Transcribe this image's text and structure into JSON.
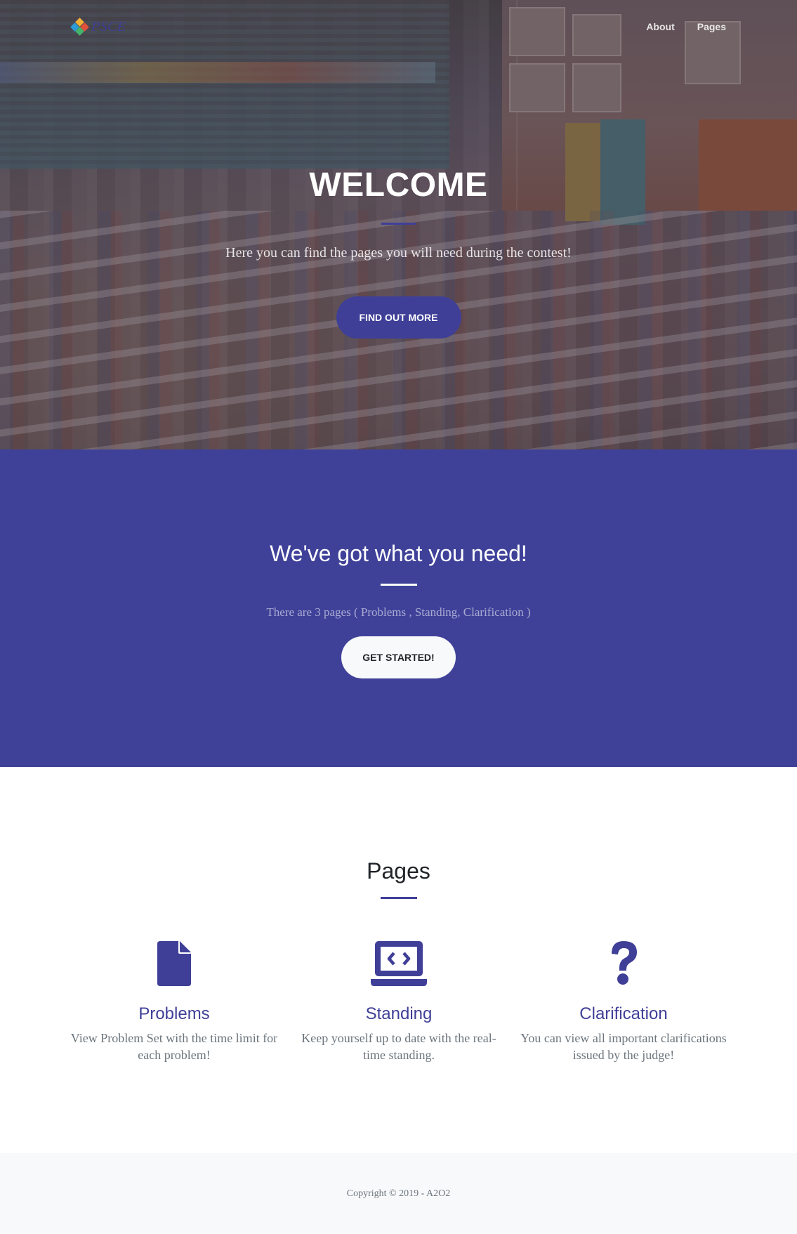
{
  "nav": {
    "brand": "PSCE",
    "links": [
      {
        "label": "About"
      },
      {
        "label": "Pages"
      }
    ]
  },
  "hero": {
    "title": "WELCOME",
    "subtitle": "Here you can find the pages you will need during the contest!",
    "button_label": "FIND OUT MORE"
  },
  "about": {
    "title": "We've got what you need!",
    "text": "There are 3 pages ( Problems , Standing, Clarification )",
    "button_label": "GET STARTED!"
  },
  "services": {
    "title": "Pages",
    "items": [
      {
        "icon": "file-icon",
        "title": "Problems",
        "description": "View Problem Set with the time limit for each problem!"
      },
      {
        "icon": "laptop-code-icon",
        "title": "Standing",
        "description": "Keep yourself up to date with the real-time standing."
      },
      {
        "icon": "question-icon",
        "title": "Clarification",
        "description": "You can view all important clarifications issued by the judge!"
      }
    ]
  },
  "footer": {
    "copyright": "Copyright © 2019 - A2O2"
  },
  "colors": {
    "primary": "#3f3f98",
    "section_bg": "#3f4199",
    "footer_bg": "#f8f9fa",
    "muted_text": "#6c757d"
  }
}
